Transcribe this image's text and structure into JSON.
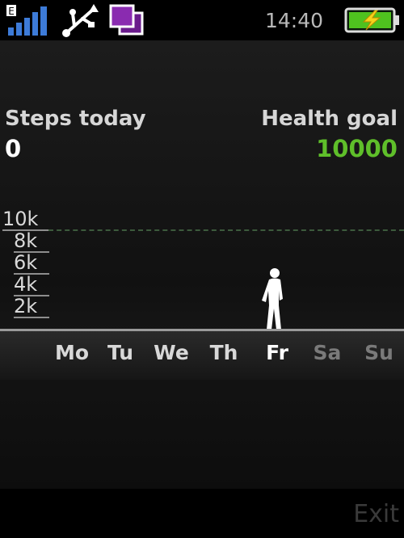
{
  "statusbar": {
    "time": "14:40",
    "signal_icon": "signal-bars-icon",
    "usb_icon": "usb-icon",
    "app_icon": "purple-windows-icon",
    "battery_icon": "battery-charging-icon",
    "signal_badge": "E"
  },
  "summary": {
    "steps_label": "Steps today",
    "steps_value": "0",
    "goal_label": "Health goal",
    "goal_value": "10000",
    "goal_color": "#5fbf2a"
  },
  "chart_data": {
    "type": "bar",
    "categories": [
      "Mo",
      "Tu",
      "We",
      "Th",
      "Fr",
      "Sa",
      "Su"
    ],
    "values": [
      0,
      0,
      0,
      0,
      0,
      null,
      null
    ],
    "y_ticks": [
      "10k",
      "8k",
      "6k",
      "4k",
      "2k"
    ],
    "ylim": [
      0,
      10000
    ],
    "goal": 10000,
    "current_day": "Fr"
  },
  "softkeys": {
    "right_label": "Exit"
  }
}
